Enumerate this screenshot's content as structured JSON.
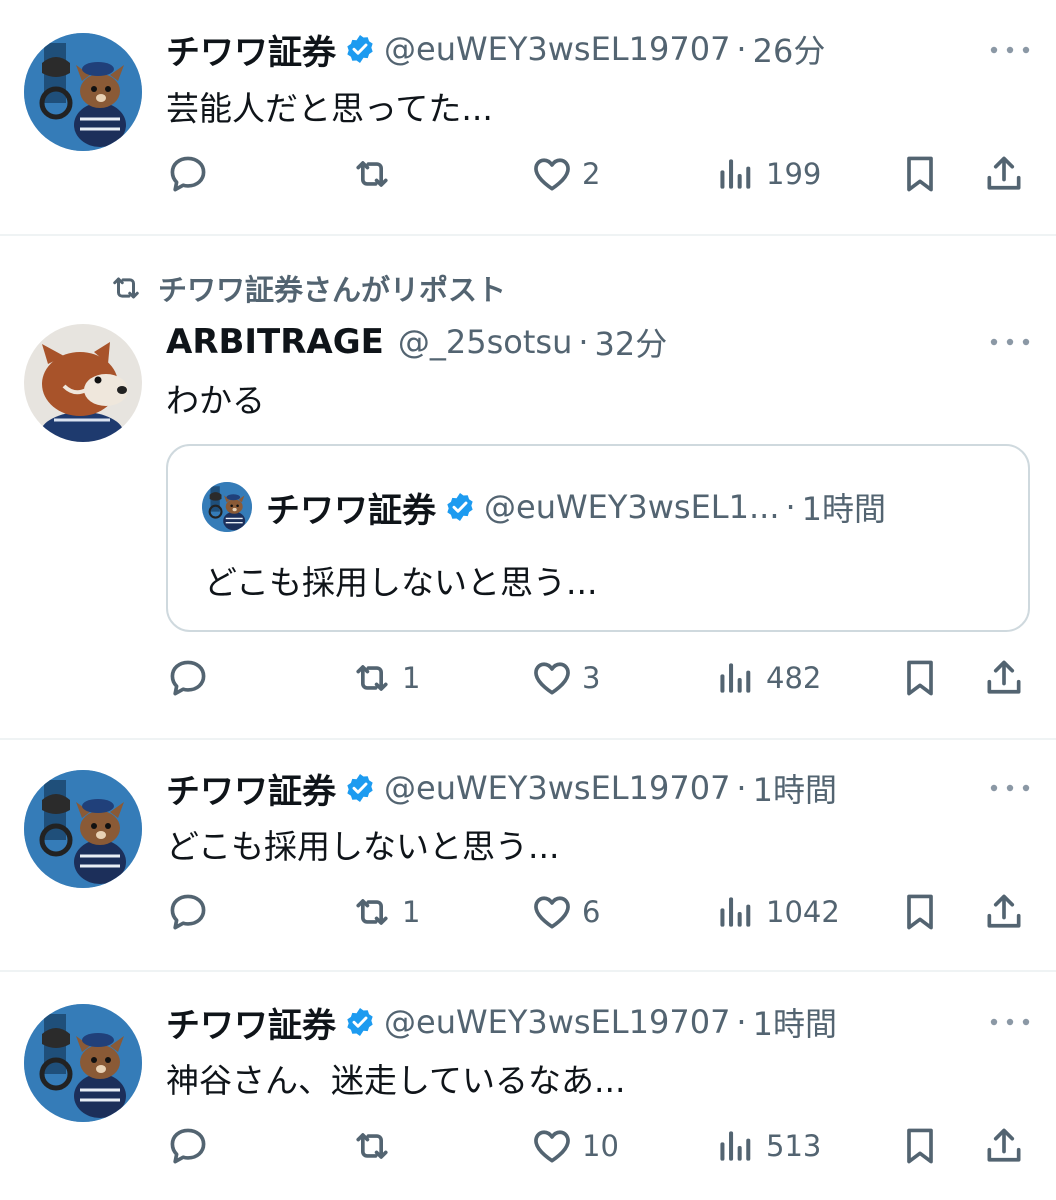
{
  "colors": {
    "verified": "#1d9bf0",
    "secondary": "#536471",
    "text": "#0f1419",
    "divider": "#eff3f4"
  },
  "tweets": [
    {
      "name": "チワワ証券",
      "handle": "@euWEY3wsEL19707",
      "time": "26分",
      "text": "芸能人だと思ってた...",
      "reply_count": "",
      "repost_count": "",
      "like_count": "2",
      "view_count": "199"
    },
    {
      "repost_label": "チワワ証券さんがリポスト",
      "name": "ARBITRAGE",
      "handle": "@_25sotsu",
      "time": "32分",
      "text": "わかる",
      "quote": {
        "name": "チワワ証券",
        "handle": "@euWEY3wsEL1...",
        "time": "1時間",
        "text": "どこも採用しないと思う..."
      },
      "reply_count": "",
      "repost_count": "1",
      "like_count": "3",
      "view_count": "482"
    },
    {
      "name": "チワワ証券",
      "handle": "@euWEY3wsEL19707",
      "time": "1時間",
      "text": "どこも採用しないと思う...",
      "reply_count": "",
      "repost_count": "1",
      "like_count": "6",
      "view_count": "1042"
    },
    {
      "name": "チワワ証券",
      "handle": "@euWEY3wsEL19707",
      "time": "1時間",
      "text": "神谷さん、迷走しているなあ...",
      "reply_count": "",
      "repost_count": "",
      "like_count": "10",
      "view_count": "513"
    }
  ],
  "separator": "·"
}
